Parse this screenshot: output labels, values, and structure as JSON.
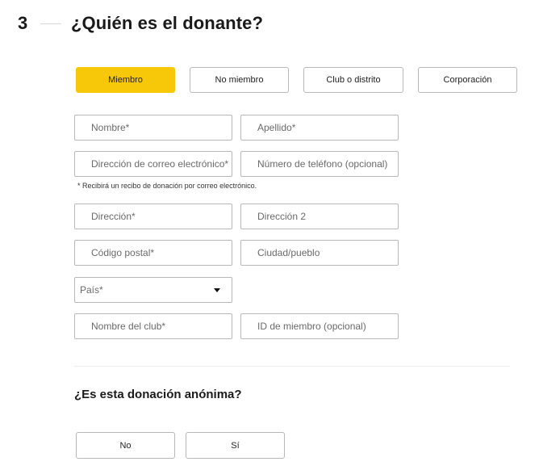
{
  "step": {
    "number": "3",
    "title": "¿Quién es el donante?"
  },
  "donor_type": {
    "options": [
      "Miembro",
      "No miembro",
      "Club o distrito",
      "Corporación"
    ],
    "selected": "Miembro"
  },
  "fields": {
    "first_name": "Nombre*",
    "last_name": "Apellido*",
    "email": "Dirección de correo electrónico*",
    "phone": "Número de teléfono (opcional)",
    "email_note": "* Recibirá un recibo de donación por correo electrónico.",
    "address": "Dirección*",
    "address2": "Dirección 2",
    "postal_code": "Código postal*",
    "city": "Ciudad/pueblo",
    "country": "País*",
    "club_name": "Nombre del club*",
    "member_id": "ID de miembro (opcional)"
  },
  "anonymous": {
    "question": "¿Es esta donación anónima?",
    "no": "No",
    "yes": "Sí"
  },
  "colors": {
    "accent": "#f7c70a",
    "border": "#b8b8b8"
  }
}
